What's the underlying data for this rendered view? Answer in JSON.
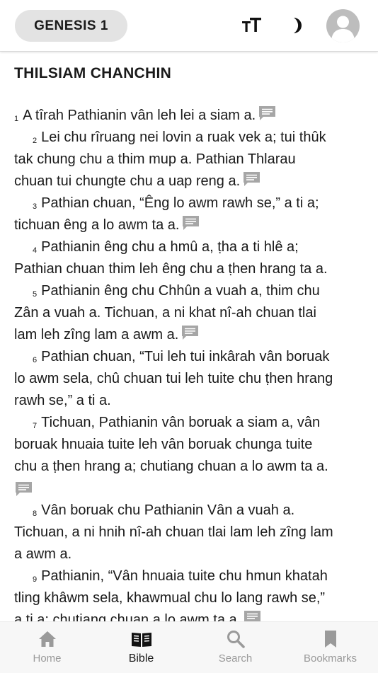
{
  "header": {
    "chapter_label": "GENESIS 1",
    "icons": [
      "text-size-icon",
      "dark-mode-icon",
      "profile-avatar"
    ]
  },
  "section_title": "THILSIAM CHANCHIN",
  "verses": [
    {
      "n": "1",
      "lines": [
        "A tîrah Pathianin vân leh lei a siam a."
      ],
      "note": true
    },
    {
      "n": "2",
      "lines": [
        "Lei chu rîruang nei lovin a ruak vek a; tui thûk",
        "tak chung chu a thim mup a. Pathian Thlarau",
        "chuan tui chungte chu a uap reng a."
      ],
      "note": true
    },
    {
      "n": "3",
      "lines": [
        "Pathian chuan, “Êng lo awm rawh se,” a ti a;",
        "tichuan êng a lo awm ta a."
      ],
      "note": true
    },
    {
      "n": "4",
      "lines": [
        "Pathianin êng chu a hmû a, ṭha a ti hlê a;",
        "Pathian chuan thim leh êng chu a ṭhen hrang ta a."
      ],
      "note": false
    },
    {
      "n": "5",
      "lines": [
        "Pathianin êng chu Chhûn a vuah a, thim chu",
        "Zân a vuah a. Tichuan, a ni khat nî-ah chuan tlai",
        "lam leh zîng lam a awm a."
      ],
      "note": true
    },
    {
      "n": "6",
      "lines": [
        "Pathian chuan, “Tui leh tui inkârah vân boruak",
        "lo awm sela, chû chuan tui leh tuite chu ṭhen hrang",
        "rawh se,” a ti a."
      ],
      "note": false
    },
    {
      "n": "7",
      "lines": [
        "Tichuan, Pathianin vân boruak a siam a, vân",
        "boruak hnuaia tuite leh vân boruak chunga tuite",
        "chu a ṭhen hrang a; chutiang chuan a lo awm ta a."
      ],
      "note": true,
      "note_own_line": true
    },
    {
      "n": "8",
      "lines": [
        "Vân boruak chu Pathianin Vân a vuah a.",
        "Tichuan, a ni hnih nî-ah chuan tlai lam leh zîng lam",
        "a awm a."
      ],
      "note": false
    },
    {
      "n": "9",
      "lines": [
        "Pathianin, “Vân hnuaia tuite chu hmun khatah",
        "tling khâwm sela, khawmual chu lo lang rawh se,”",
        "a ti a; chutiang chuan a lo awm ta a."
      ],
      "note": true
    }
  ],
  "tabs": [
    {
      "label": "Home",
      "icon": "home-icon",
      "active": false
    },
    {
      "label": "Bible",
      "icon": "bible-icon",
      "active": true
    },
    {
      "label": "Search",
      "icon": "search-icon",
      "active": false
    },
    {
      "label": "Bookmarks",
      "icon": "bookmark-icon",
      "active": false
    }
  ],
  "colors": {
    "text": "#1a1a1a",
    "chapter_button_bg": "#e3e3e3",
    "inactive_tab": "#9a9a9a",
    "note_icon": "#a6a6a6",
    "tabbar_bg": "#f7f7f7"
  }
}
